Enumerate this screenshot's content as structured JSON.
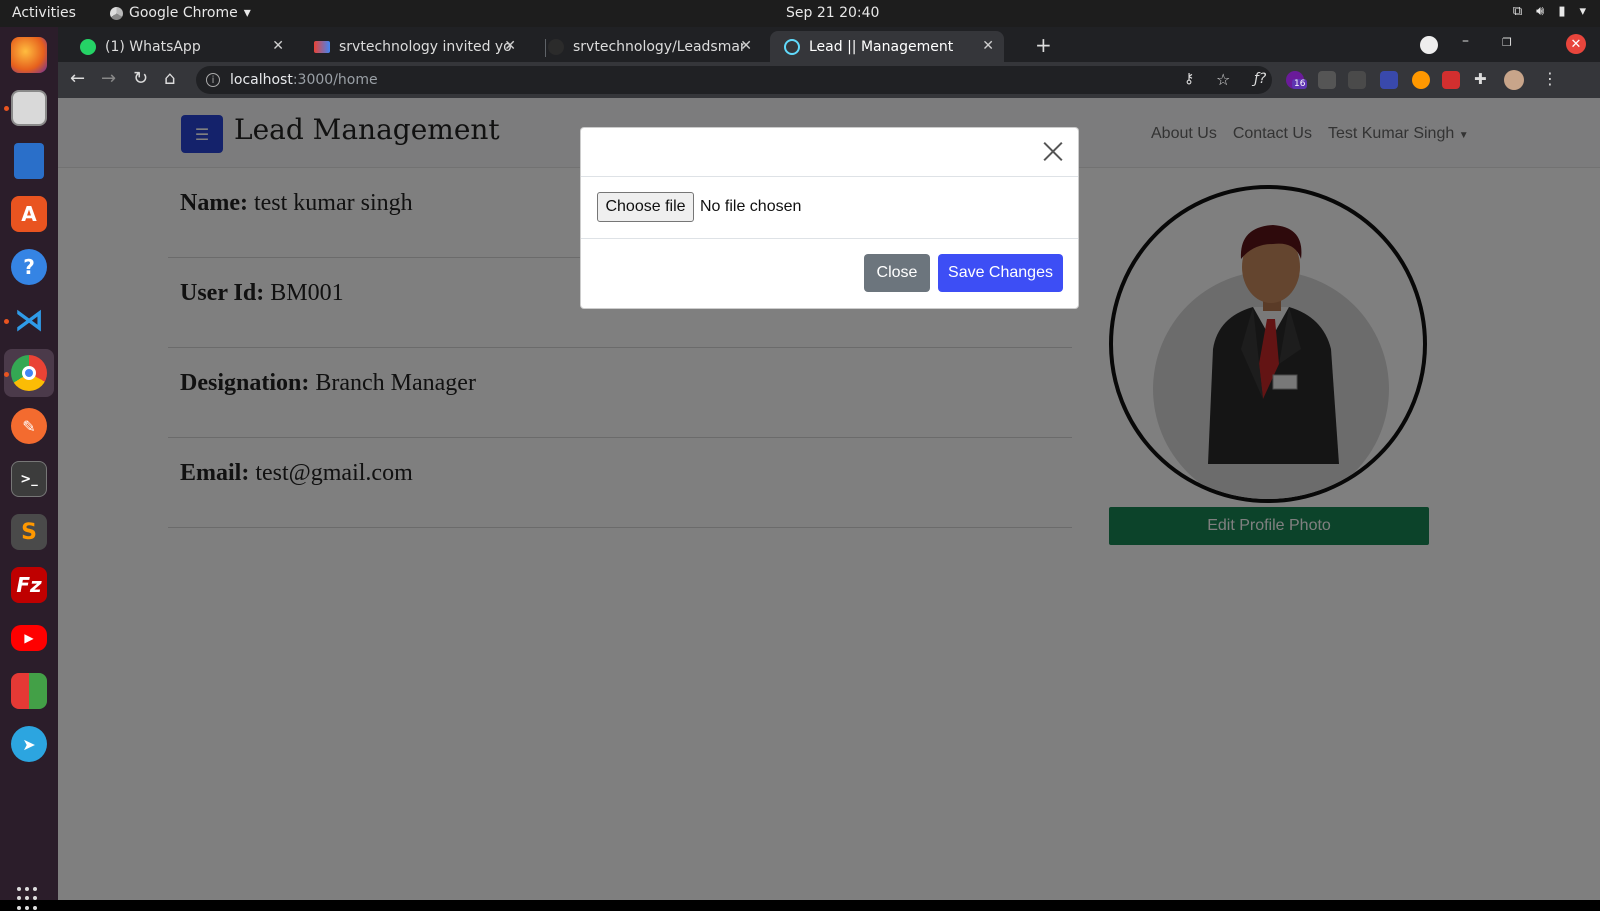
{
  "system": {
    "activities": "Activities",
    "app_menu": "Google Chrome",
    "clock": "Sep 21  20:40"
  },
  "dock": {
    "items": [
      "firefox-icon",
      "files-icon",
      "writer-icon",
      "software-store-icon",
      "help-icon",
      "vscode-icon",
      "chrome-icon",
      "inkscape-icon",
      "terminal-icon",
      "sublime-icon",
      "filezilla-icon",
      "youtube-icon",
      "app-icon",
      "telegram-icon"
    ]
  },
  "browser": {
    "tabs": [
      {
        "title": "(1) WhatsApp",
        "icon": "whatsapp-icon"
      },
      {
        "title": "srvtechnology invited you",
        "icon": "gmail-icon"
      },
      {
        "title": "srvtechnology/Leadsman",
        "icon": "github-icon"
      },
      {
        "title": "Lead || Management",
        "icon": "react-icon",
        "active": true
      }
    ],
    "url_host": "localhost",
    "url_path": ":3000/home",
    "extension_badge": "16"
  },
  "page": {
    "brand": "Lead Management",
    "nav": {
      "about": "About Us",
      "contact": "Contact Us",
      "user": "Test Kumar Singh"
    },
    "profile": {
      "name_label": "Name:",
      "name_value": "test kumar singh",
      "userid_label": "User Id:",
      "userid_value": "BM001",
      "designation_label": "Designation:",
      "designation_value": "Branch Manager",
      "email_label": "Email:",
      "email_value": "test@gmail.com"
    },
    "edit_photo": "Edit Profile Photo"
  },
  "modal": {
    "file_button": "Choose file",
    "file_status": "No file chosen",
    "close_label": "Close",
    "save_label": "Save Changes"
  },
  "colors": {
    "primary": "#3d4ef5",
    "success": "#198754",
    "secondary": "#6c757d"
  }
}
